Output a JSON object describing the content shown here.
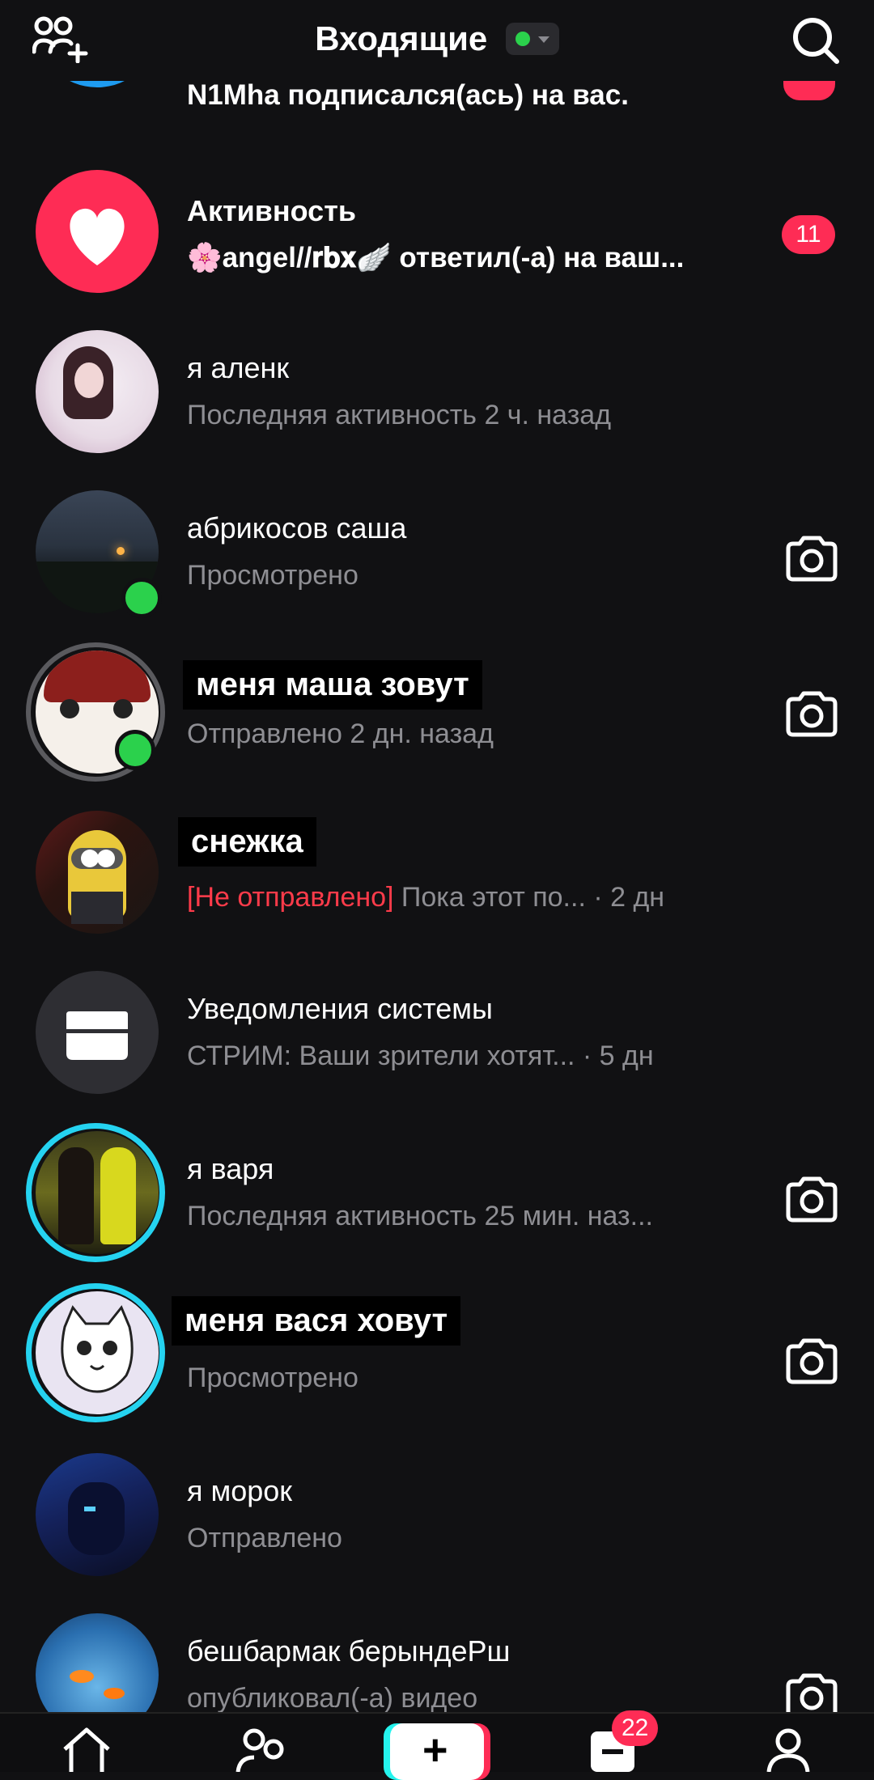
{
  "header": {
    "title": "Входящие",
    "left_icon": "add-friends-icon",
    "search_icon": "search-icon",
    "status_color": "#2bd14c"
  },
  "rows": [
    {
      "type": "follower",
      "sub": "N1Mha подписался(ась) на вас."
    },
    {
      "type": "activity",
      "name": "Активность",
      "sub": "🌸angel//𝐫𝐛𝐱🪽 ответил(-а) на ваш...",
      "badge": "11"
    },
    {
      "name": "я аленк",
      "sub": "Последняя активность 2 ч. назад"
    },
    {
      "name": "абрикосов саша",
      "sub": "Просмотрено",
      "online": true,
      "camera": true
    },
    {
      "name": "меня маша зовут",
      "sub": "Отправлено 2 дн. назад",
      "online": true,
      "camera": true
    },
    {
      "name": "снежка",
      "sub_red": "[Не отправлено]",
      "sub": " Пока этот по... · 2 дн"
    },
    {
      "name": "Уведомления системы",
      "sub": "СТРИМ: Ваши зрители хотят...   · 5 дн"
    },
    {
      "name": "я варя",
      "sub": "Последняя активность 25 мин. наз...",
      "camera": true
    },
    {
      "name": "меня вася ховут",
      "sub": "Просмотрено",
      "camera": true
    },
    {
      "name": "я морок",
      "sub": "Отправлено"
    },
    {
      "name": "бешбармак берындеРш",
      "sub": "опубликовал(-а) видео",
      "camera": true
    }
  ],
  "tabbar": {
    "home_icon": "home-icon",
    "friends_icon": "friends-icon",
    "create_label": "+",
    "inbox_icon": "inbox-icon",
    "inbox_badge": "22",
    "profile_icon": "profile-icon"
  },
  "colors": {
    "background": "#111113",
    "accent_red": "#fe2c55",
    "accent_cyan": "#25f4ee",
    "online": "#2bd14c"
  }
}
